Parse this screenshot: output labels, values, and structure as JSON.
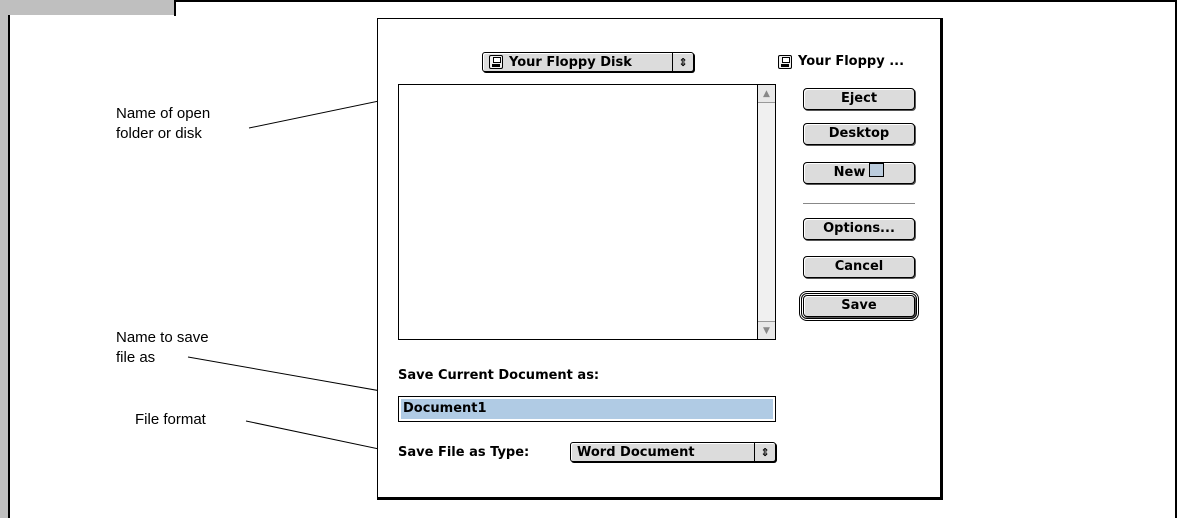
{
  "callouts": {
    "open_folder": "Name of open\nfolder or disk",
    "save_name": "Name to save\nfile as",
    "file_format": "File format"
  },
  "dialog": {
    "location_popup": "Your Floppy Disk",
    "volume_label": "Your Floppy ...",
    "buttons": {
      "eject": "Eject",
      "desktop": "Desktop",
      "new": "New",
      "options": "Options...",
      "cancel": "Cancel",
      "save": "Save"
    },
    "save_prompt": "Save Current Document as:",
    "filename_value": "Document1",
    "type_label": "Save File as Type:",
    "type_value": "Word Document",
    "popup_arrows": "⇕"
  },
  "icons": {
    "floppy": "floppy-disk-icon",
    "folder": "folder-icon"
  },
  "colors": {
    "selection": "#b0cbe4",
    "button_face": "#dcdcdc",
    "frame_gray": "#bfbfbf"
  }
}
